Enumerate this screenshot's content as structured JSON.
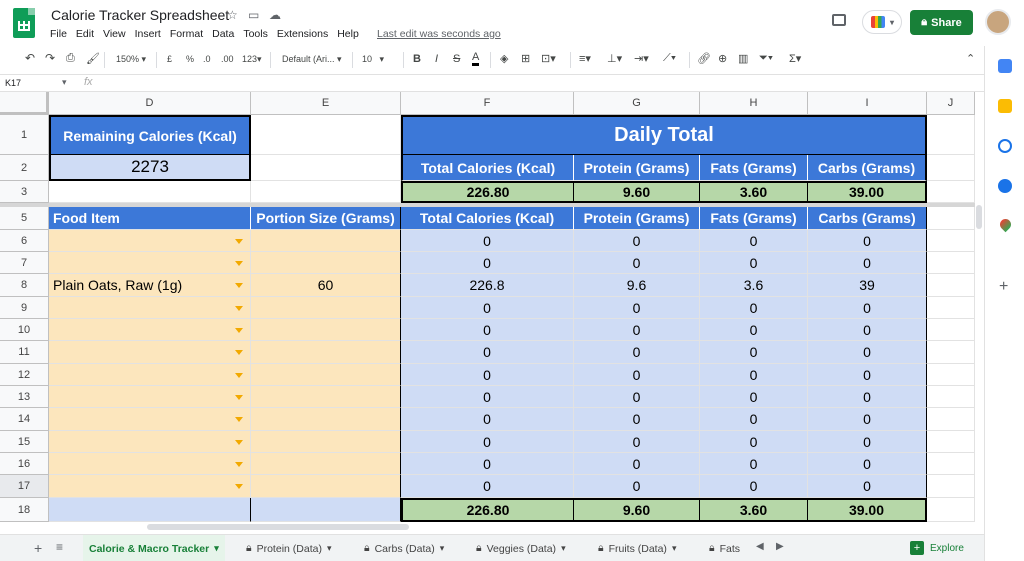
{
  "app": {
    "title": "Calorie Tracker Spreadsheet",
    "menu": [
      "File",
      "Edit",
      "View",
      "Insert",
      "Format",
      "Data",
      "Tools",
      "Extensions",
      "Help"
    ],
    "last_edit": "Last edit was seconds ago",
    "share_label": "Share"
  },
  "toolbar": {
    "zoom": "150%",
    "currency": "£",
    "percent": "%",
    "dec_dec": ".0",
    "dec_inc": ".00",
    "number_format": "123",
    "font": "Default (Ari...",
    "font_size": "10",
    "bold": "B",
    "italic": "I",
    "strike": "S",
    "text_color": "A"
  },
  "formula_bar": {
    "name_box": "K17",
    "fx": "fx"
  },
  "columns": [
    "D",
    "E",
    "F",
    "G",
    "H",
    "I",
    "J"
  ],
  "rows": [
    "1",
    "2",
    "3",
    "5",
    "6",
    "7",
    "8",
    "9",
    "10",
    "11",
    "12",
    "13",
    "14",
    "15",
    "16",
    "17",
    "18"
  ],
  "sheet": {
    "remaining_header": "Remaining Calories (Kcal)",
    "remaining_value": "2273",
    "daily_total_title": "Daily Total",
    "daily_headers": [
      "Total Calories (Kcal)",
      "Protein (Grams)",
      "Fats (Grams)",
      "Carbs (Grams)"
    ],
    "daily_values": [
      "226.80",
      "9.60",
      "3.60",
      "39.00"
    ],
    "table_headers": [
      "Food Item",
      "Portion Size (Grams)",
      "Total Calories (Kcal)",
      "Protein (Grams)",
      "Fats (Grams)",
      "Carbs (Grams)"
    ],
    "rows": [
      {
        "food": "",
        "portion": "",
        "cal": "0",
        "protein": "0",
        "fats": "0",
        "carbs": "0"
      },
      {
        "food": "",
        "portion": "",
        "cal": "0",
        "protein": "0",
        "fats": "0",
        "carbs": "0"
      },
      {
        "food": "Plain Oats, Raw (1g)",
        "portion": "60",
        "cal": "226.8",
        "protein": "9.6",
        "fats": "3.6",
        "carbs": "39"
      },
      {
        "food": "",
        "portion": "",
        "cal": "0",
        "protein": "0",
        "fats": "0",
        "carbs": "0"
      },
      {
        "food": "",
        "portion": "",
        "cal": "0",
        "protein": "0",
        "fats": "0",
        "carbs": "0"
      },
      {
        "food": "",
        "portion": "",
        "cal": "0",
        "protein": "0",
        "fats": "0",
        "carbs": "0"
      },
      {
        "food": "",
        "portion": "",
        "cal": "0",
        "protein": "0",
        "fats": "0",
        "carbs": "0"
      },
      {
        "food": "",
        "portion": "",
        "cal": "0",
        "protein": "0",
        "fats": "0",
        "carbs": "0"
      },
      {
        "food": "",
        "portion": "",
        "cal": "0",
        "protein": "0",
        "fats": "0",
        "carbs": "0"
      },
      {
        "food": "",
        "portion": "",
        "cal": "0",
        "protein": "0",
        "fats": "0",
        "carbs": "0"
      },
      {
        "food": "",
        "portion": "",
        "cal": "0",
        "protein": "0",
        "fats": "0",
        "carbs": "0"
      },
      {
        "food": "",
        "portion": "",
        "cal": "0",
        "protein": "0",
        "fats": "0",
        "carbs": "0"
      }
    ],
    "totals": [
      "226.80",
      "9.60",
      "3.60",
      "39.00"
    ]
  },
  "tabs": [
    {
      "label": "Calorie & Macro Tracker",
      "active": true
    },
    {
      "label": "Protein (Data)",
      "active": false
    },
    {
      "label": "Carbs (Data)",
      "active": false
    },
    {
      "label": "Veggies (Data)",
      "active": false
    },
    {
      "label": "Fruits (Data)",
      "active": false
    },
    {
      "label": "Fats",
      "active": false
    }
  ],
  "explore_label": "Explore",
  "colors": {
    "header_blue": "#3c78d8",
    "light_blue": "#cfdcf5",
    "yellow": "#fce6bd",
    "green": "#b6d7a8",
    "share_green": "#188038"
  }
}
